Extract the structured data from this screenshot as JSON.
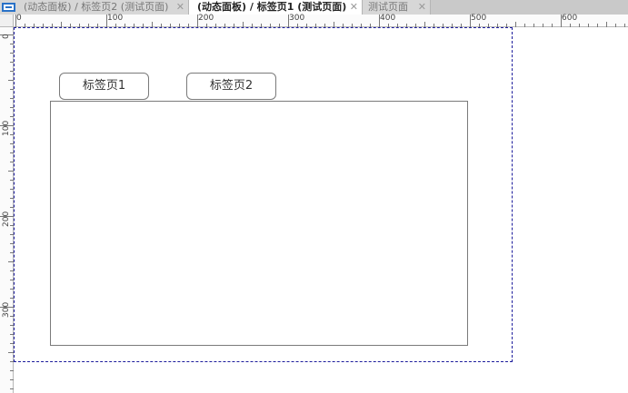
{
  "tabs": [
    {
      "label": "(动态面板) / 标签页2 (测试页面)",
      "active": false
    },
    {
      "label": "(动态面板) / 标签页1 (测试页面)",
      "active": true
    },
    {
      "label": "测试页面",
      "active": false
    }
  ],
  "tab_close_glyph": "✕",
  "ruler": {
    "top_labels": [
      "0",
      "100",
      "200",
      "300",
      "400",
      "500",
      "600"
    ],
    "left_labels": [
      "0",
      "100",
      "200",
      "300"
    ]
  },
  "canvas": {
    "tab_button_1": "标签页1",
    "tab_button_2": "标签页2"
  },
  "colors": {
    "canvas_border": "#1c1c9c",
    "tabbar_bg": "#c9c9c9",
    "active_tab_bg": "#ffffff"
  },
  "icons": {
    "app": "app-page-icon",
    "close": "close-icon"
  }
}
